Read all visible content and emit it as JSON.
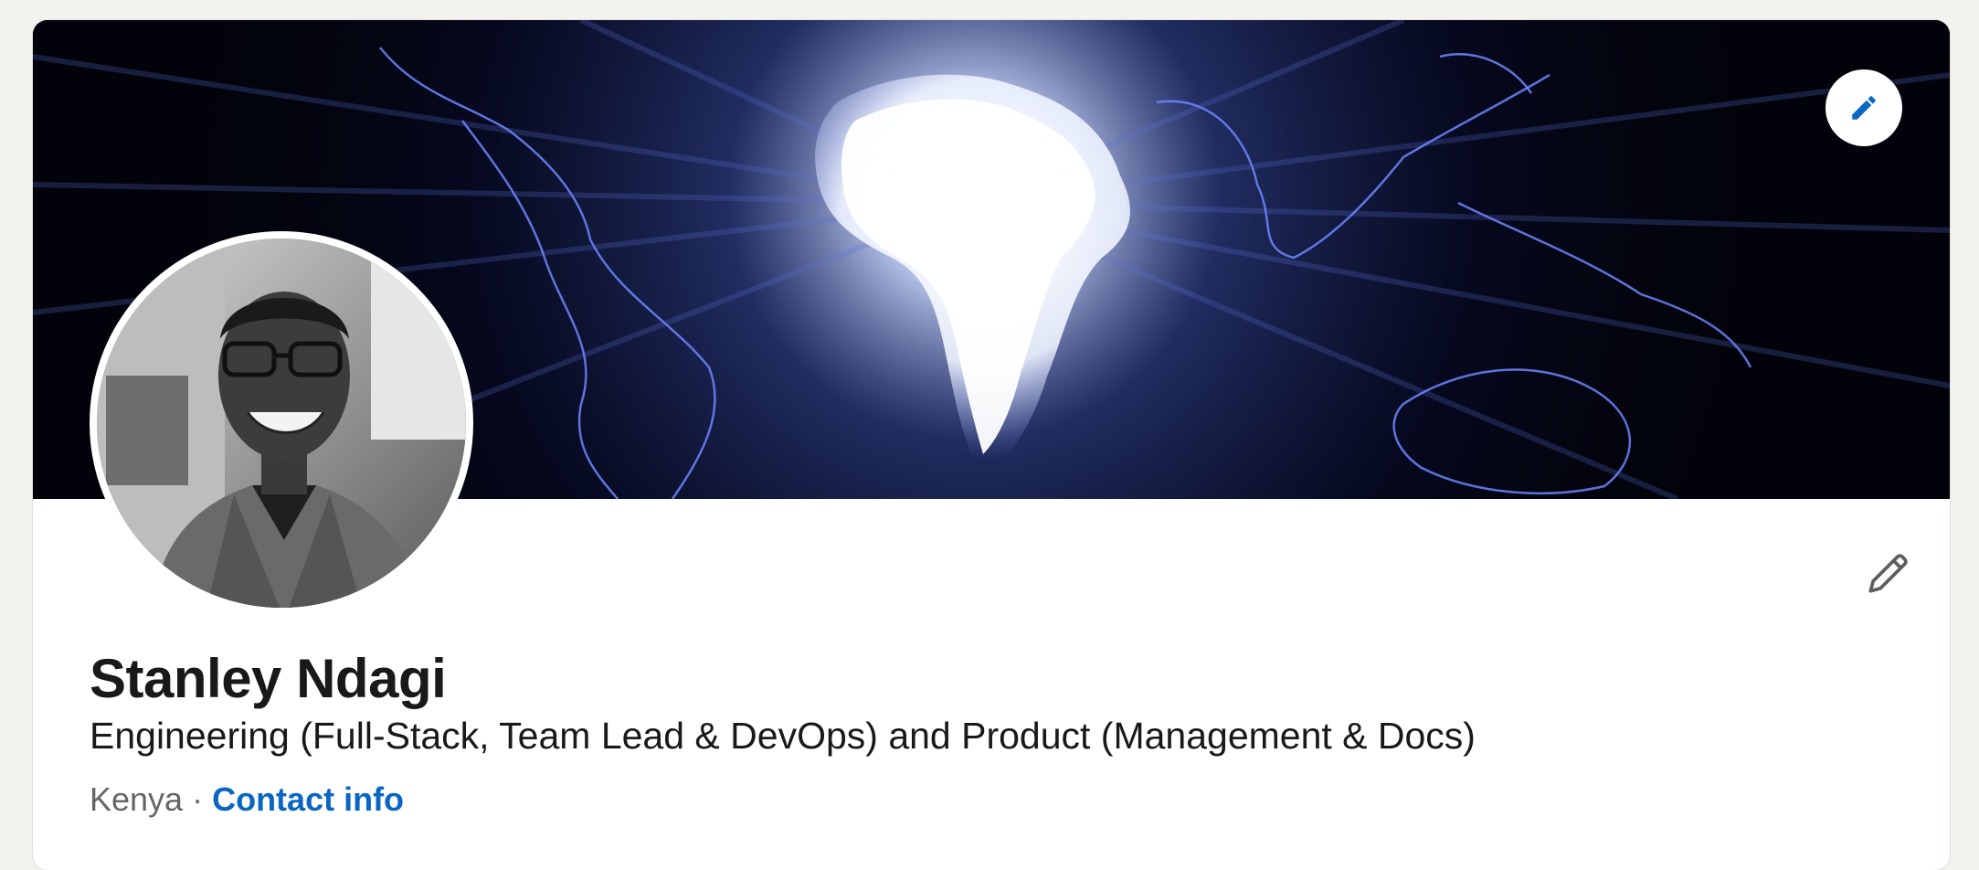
{
  "profile": {
    "name": "Stanley Ndagi",
    "headline": "Engineering (Full-Stack, Team Lead & DevOps) and Product (Management & Docs)",
    "location": "Kenya",
    "separator": "·",
    "contact_label": "Contact info"
  },
  "icons": {
    "banner_edit": "pencil-icon",
    "intro_edit": "pencil-icon"
  },
  "colors": {
    "link": "#0a66c2",
    "text": "#191919",
    "muted": "#666666",
    "page_background": "#f4f2ee"
  }
}
